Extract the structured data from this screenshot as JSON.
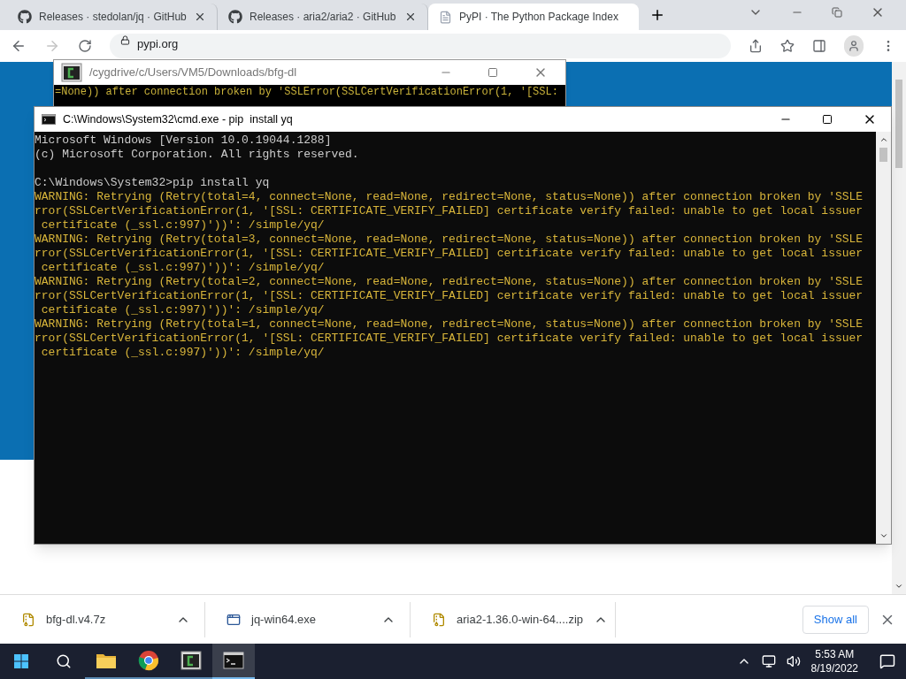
{
  "browser": {
    "tabs": [
      {
        "title": "Releases · stedolan/jq · GitHub",
        "selected": false
      },
      {
        "title": "Releases · aria2/aria2 · GitHub",
        "selected": false
      },
      {
        "title": "PyPI · The Python Package Index",
        "selected": true
      }
    ],
    "address": "pypi.org",
    "downloads": [
      {
        "name": "bfg-dl.v4.7z"
      },
      {
        "name": "jq-win64.exe"
      },
      {
        "name": "aria2-1.36.0-win-64....zip"
      }
    ],
    "show_all": "Show all"
  },
  "cygwin_window": {
    "title": "/cygdrive/c/Users/VM5/Downloads/bfg-dl",
    "lines": [
      "=None)) after connection broken by 'SSLError(SSLCertVerificationError(1, '[SSL:"
    ]
  },
  "cmd_window": {
    "title": "C:\\Windows\\System32\\cmd.exe - pip  install yq",
    "lines": [
      {
        "kind": "output",
        "text": "Microsoft Windows [Version 10.0.19044.1288]"
      },
      {
        "kind": "output",
        "text": "(c) Microsoft Corporation. All rights reserved."
      },
      {
        "kind": "prompt",
        "text": "C:\\Windows\\System32>pip install yq"
      },
      {
        "kind": "warning",
        "text": "WARNING: Retrying (Retry(total=4, connect=None, read=None, redirect=None, status=None)) after connection broken by 'SSLE"
      },
      {
        "kind": "warning",
        "text": "rror(SSLCertVerificationError(1, '[SSL: CERTIFICATE_VERIFY_FAILED] certificate verify failed: unable to get local issuer"
      },
      {
        "kind": "warning",
        "text": " certificate (_ssl.c:997)'))': /simple/yq/"
      },
      {
        "kind": "warning",
        "text": "WARNING: Retrying (Retry(total=3, connect=None, read=None, redirect=None, status=None)) after connection broken by 'SSLE"
      },
      {
        "kind": "warning",
        "text": "rror(SSLCertVerificationError(1, '[SSL: CERTIFICATE_VERIFY_FAILED] certificate verify failed: unable to get local issuer"
      },
      {
        "kind": "warning",
        "text": " certificate (_ssl.c:997)'))': /simple/yq/"
      },
      {
        "kind": "warning",
        "text": "WARNING: Retrying (Retry(total=2, connect=None, read=None, redirect=None, status=None)) after connection broken by 'SSLE"
      },
      {
        "kind": "warning",
        "text": "rror(SSLCertVerificationError(1, '[SSL: CERTIFICATE_VERIFY_FAILED] certificate verify failed: unable to get local issuer"
      },
      {
        "kind": "warning",
        "text": " certificate (_ssl.c:997)'))': /simple/yq/"
      },
      {
        "kind": "warning",
        "text": "WARNING: Retrying (Retry(total=1, connect=None, read=None, redirect=None, status=None)) after connection broken by 'SSLE"
      },
      {
        "kind": "warning",
        "text": "rror(SSLCertVerificationError(1, '[SSL: CERTIFICATE_VERIFY_FAILED] certificate verify failed: unable to get local issuer"
      },
      {
        "kind": "warning",
        "text": " certificate (_ssl.c:997)'))': /simple/yq/"
      }
    ]
  },
  "taskbar": {
    "apps": [
      {
        "kind": "explorer",
        "active": false
      },
      {
        "kind": "chrome",
        "active": false
      },
      {
        "kind": "cygwin",
        "active": false
      },
      {
        "kind": "cmd",
        "active": true
      }
    ],
    "time": "5:53 AM",
    "date": "8/19/2022"
  }
}
